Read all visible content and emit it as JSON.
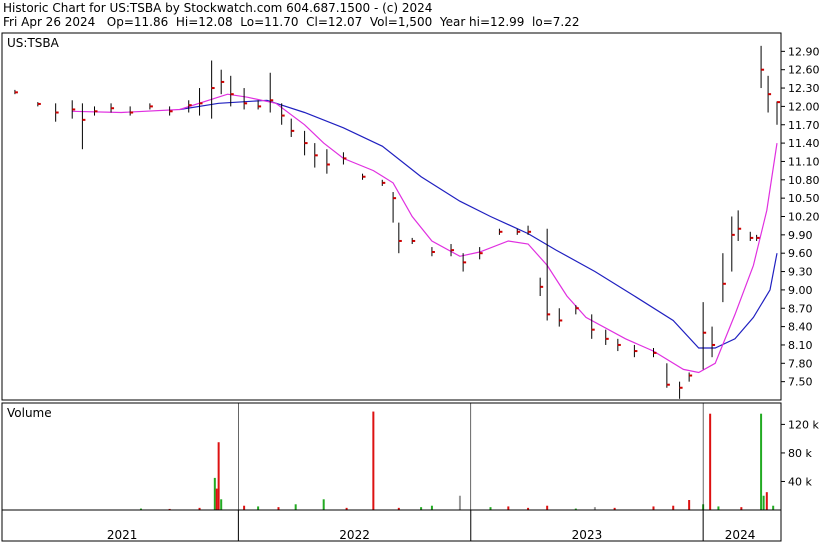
{
  "header": {
    "line1": "Historic Chart for US:TSBA by Stockwatch.com 604.687.1500 - (c) 2024",
    "line2": "Fri Apr 26 2024   Op=11.86  Hi=12.08  Lo=11.70  Cl=12.07  Vol=1,500  Year hi=12.99  lo=7.22"
  },
  "colors": {
    "background": "#ffffff",
    "axis": "#000000",
    "price_bar": "#000000",
    "close_tick": "#cc0000",
    "ma_short": "#e030e0",
    "ma_long": "#2020c0",
    "volume_up": "#22aa22",
    "volume_down": "#dd1111",
    "volume_flat": "#999999"
  },
  "chart_data": [
    {
      "type": "line",
      "title": "US:TSBA",
      "ylabel": "",
      "y_ticks": [
        7.5,
        7.8,
        8.1,
        8.4,
        8.7,
        9.0,
        9.3,
        9.6,
        9.9,
        10.2,
        10.5,
        10.8,
        11.1,
        11.4,
        11.7,
        12.0,
        12.3,
        12.6,
        12.9
      ],
      "ylim": [
        7.2,
        13.2
      ],
      "x_labels": [
        "2021",
        "2022",
        "2023",
        "2024"
      ],
      "xlim": [
        "2021-01-01",
        "2024-04-26"
      ],
      "series": [
        {
          "kind": "price",
          "points": [
            [
              "2021-01-15",
              12.2,
              12.27,
              12.23
            ],
            [
              "2021-02-20",
              12.0,
              12.07,
              12.04
            ],
            [
              "2021-03-20",
              11.75,
              12.05,
              11.9
            ],
            [
              "2021-04-15",
              11.8,
              12.1,
              11.95
            ],
            [
              "2021-05-01",
              11.3,
              12.05,
              11.78
            ],
            [
              "2021-05-20",
              11.85,
              12.0,
              11.92
            ],
            [
              "2021-06-15",
              11.9,
              12.05,
              11.97
            ],
            [
              "2021-07-15",
              11.85,
              12.0,
              11.9
            ],
            [
              "2021-08-15",
              11.95,
              12.05,
              12.0
            ],
            [
              "2021-09-15",
              11.85,
              12.0,
              11.92
            ],
            [
              "2021-10-15",
              11.9,
              12.1,
              12.02
            ],
            [
              "2021-11-01",
              11.85,
              12.3,
              12.05
            ],
            [
              "2021-11-20",
              11.8,
              12.75,
              12.3
            ],
            [
              "2021-12-05",
              12.2,
              12.6,
              12.4
            ],
            [
              "2021-12-20",
              12.0,
              12.5,
              12.2
            ],
            [
              "2022-01-10",
              11.95,
              12.3,
              12.05
            ],
            [
              "2022-02-01",
              11.95,
              12.1,
              12.0
            ],
            [
              "2022-02-20",
              11.9,
              12.55,
              12.1
            ],
            [
              "2022-03-10",
              11.7,
              12.05,
              11.85
            ],
            [
              "2022-03-25",
              11.5,
              11.8,
              11.6
            ],
            [
              "2022-04-15",
              11.2,
              11.6,
              11.4
            ],
            [
              "2022-05-01",
              11.0,
              11.4,
              11.2
            ],
            [
              "2022-05-20",
              10.9,
              11.3,
              11.05
            ],
            [
              "2022-06-15",
              11.05,
              11.25,
              11.15
            ],
            [
              "2022-07-15",
              10.8,
              10.9,
              10.85
            ],
            [
              "2022-08-15",
              10.7,
              10.8,
              10.75
            ],
            [
              "2022-09-01",
              10.1,
              10.6,
              10.5
            ],
            [
              "2022-09-10",
              9.6,
              10.1,
              9.8
            ],
            [
              "2022-10-01",
              9.75,
              9.85,
              9.8
            ],
            [
              "2022-11-01",
              9.55,
              9.7,
              9.62
            ],
            [
              "2022-12-01",
              9.55,
              9.75,
              9.65
            ],
            [
              "2022-12-20",
              9.3,
              9.6,
              9.45
            ],
            [
              "2023-01-15",
              9.5,
              9.7,
              9.6
            ],
            [
              "2023-02-15",
              9.9,
              10.0,
              9.95
            ],
            [
              "2023-03-15",
              9.9,
              10.0,
              9.95
            ],
            [
              "2023-04-01",
              9.9,
              10.05,
              9.95
            ],
            [
              "2023-04-20",
              8.9,
              9.2,
              9.05
            ],
            [
              "2023-05-01",
              8.5,
              10.0,
              8.6
            ],
            [
              "2023-05-20",
              8.4,
              8.7,
              8.5
            ],
            [
              "2023-06-15",
              8.6,
              8.75,
              8.7
            ],
            [
              "2023-07-10",
              8.2,
              8.6,
              8.35
            ],
            [
              "2023-08-01",
              8.1,
              8.35,
              8.2
            ],
            [
              "2023-08-20",
              8.0,
              8.2,
              8.1
            ],
            [
              "2023-09-15",
              7.9,
              8.1,
              8.0
            ],
            [
              "2023-10-15",
              7.9,
              8.05,
              7.97
            ],
            [
              "2023-11-05",
              7.4,
              7.8,
              7.45
            ],
            [
              "2023-11-25",
              7.22,
              7.5,
              7.4
            ],
            [
              "2023-12-10",
              7.5,
              7.65,
              7.6
            ],
            [
              "2024-01-01",
              7.7,
              8.8,
              8.3
            ],
            [
              "2024-01-15",
              7.9,
              8.4,
              8.1
            ],
            [
              "2024-02-01",
              8.8,
              9.6,
              9.1
            ],
            [
              "2024-02-15",
              9.3,
              10.2,
              9.9
            ],
            [
              "2024-02-25",
              9.8,
              10.3,
              10.0
            ],
            [
              "2024-03-15",
              9.8,
              9.95,
              9.85
            ],
            [
              "2024-03-25",
              9.8,
              9.9,
              9.85
            ],
            [
              "2024-04-01",
              12.3,
              12.99,
              12.6
            ],
            [
              "2024-04-12",
              11.9,
              12.5,
              12.2
            ],
            [
              "2024-04-26",
              11.7,
              12.08,
              12.07
            ]
          ]
        },
        {
          "kind": "moving-average-short",
          "points": [
            [
              "2021-04-15",
              11.92
            ],
            [
              "2021-07-01",
              11.9
            ],
            [
              "2021-10-01",
              11.95
            ],
            [
              "2021-12-15",
              12.2
            ],
            [
              "2022-01-15",
              12.15
            ],
            [
              "2022-03-01",
              12.05
            ],
            [
              "2022-04-15",
              11.7
            ],
            [
              "2022-05-15",
              11.4
            ],
            [
              "2022-06-15",
              11.15
            ],
            [
              "2022-08-01",
              10.95
            ],
            [
              "2022-09-01",
              10.75
            ],
            [
              "2022-10-01",
              10.2
            ],
            [
              "2022-11-01",
              9.8
            ],
            [
              "2022-12-15",
              9.55
            ],
            [
              "2023-01-15",
              9.62
            ],
            [
              "2023-03-01",
              9.8
            ],
            [
              "2023-04-01",
              9.75
            ],
            [
              "2023-05-01",
              9.4
            ],
            [
              "2023-06-01",
              8.9
            ],
            [
              "2023-07-01",
              8.55
            ],
            [
              "2023-09-01",
              8.2
            ],
            [
              "2023-10-15",
              8.0
            ],
            [
              "2023-12-01",
              7.7
            ],
            [
              "2023-12-25",
              7.65
            ],
            [
              "2024-01-20",
              7.8
            ],
            [
              "2024-02-20",
              8.6
            ],
            [
              "2024-03-20",
              9.4
            ],
            [
              "2024-04-10",
              10.3
            ],
            [
              "2024-04-26",
              11.4
            ]
          ]
        },
        {
          "kind": "moving-average-long",
          "points": [
            [
              "2021-10-01",
              11.95
            ],
            [
              "2021-12-01",
              12.05
            ],
            [
              "2022-02-15",
              12.1
            ],
            [
              "2022-04-15",
              11.9
            ],
            [
              "2022-06-15",
              11.65
            ],
            [
              "2022-08-15",
              11.35
            ],
            [
              "2022-10-15",
              10.85
            ],
            [
              "2022-12-15",
              10.45
            ],
            [
              "2023-02-01",
              10.2
            ],
            [
              "2023-04-01",
              9.92
            ],
            [
              "2023-05-15",
              9.65
            ],
            [
              "2023-07-15",
              9.3
            ],
            [
              "2023-09-15",
              8.9
            ],
            [
              "2023-11-15",
              8.5
            ],
            [
              "2023-12-25",
              8.05
            ],
            [
              "2024-01-20",
              8.05
            ],
            [
              "2024-02-20",
              8.2
            ],
            [
              "2024-03-20",
              8.55
            ],
            [
              "2024-04-15",
              9.0
            ],
            [
              "2024-04-26",
              9.6
            ]
          ]
        }
      ]
    },
    {
      "type": "bar",
      "title": "Volume",
      "y_ticks": [
        "40 k",
        "80 k",
        "120 k"
      ],
      "y_tick_values": [
        40000,
        80000,
        120000
      ],
      "ylim": [
        0,
        150000
      ],
      "bars": [
        [
          "2021-08-01",
          2000,
          "up"
        ],
        [
          "2021-09-15",
          1500,
          "down"
        ],
        [
          "2021-11-01",
          3000,
          "down"
        ],
        [
          "2021-11-25",
          45000,
          "up"
        ],
        [
          "2021-11-28",
          30000,
          "down"
        ],
        [
          "2021-12-01",
          95000,
          "down"
        ],
        [
          "2021-12-05",
          15000,
          "up"
        ],
        [
          "2022-01-10",
          6000,
          "down"
        ],
        [
          "2022-02-01",
          5000,
          "up"
        ],
        [
          "2022-03-05",
          4000,
          "down"
        ],
        [
          "2022-04-01",
          8000,
          "up"
        ],
        [
          "2022-05-15",
          15000,
          "up"
        ],
        [
          "2022-06-20",
          3000,
          "down"
        ],
        [
          "2022-08-01",
          138000,
          "down"
        ],
        [
          "2022-09-10",
          3000,
          "down"
        ],
        [
          "2022-10-15",
          4000,
          "up"
        ],
        [
          "2022-11-01",
          6000,
          "up"
        ],
        [
          "2022-12-15",
          20000,
          "flat"
        ],
        [
          "2023-02-01",
          4000,
          "up"
        ],
        [
          "2023-03-01",
          5000,
          "down"
        ],
        [
          "2023-04-01",
          3000,
          "down"
        ],
        [
          "2023-05-01",
          6000,
          "down"
        ],
        [
          "2023-06-15",
          2000,
          "up"
        ],
        [
          "2023-07-15",
          4000,
          "flat"
        ],
        [
          "2023-08-15",
          3000,
          "down"
        ],
        [
          "2023-10-15",
          5000,
          "down"
        ],
        [
          "2023-11-15",
          6000,
          "down"
        ],
        [
          "2023-12-10",
          14000,
          "down"
        ],
        [
          "2024-01-01",
          8000,
          "up"
        ],
        [
          "2024-01-12",
          135000,
          "down"
        ],
        [
          "2024-01-25",
          5000,
          "up"
        ],
        [
          "2024-03-01",
          4000,
          "down"
        ],
        [
          "2024-04-01",
          135000,
          "up"
        ],
        [
          "2024-04-05",
          20000,
          "up"
        ],
        [
          "2024-04-10",
          25000,
          "down"
        ],
        [
          "2024-04-20",
          6000,
          "up"
        ]
      ]
    }
  ]
}
